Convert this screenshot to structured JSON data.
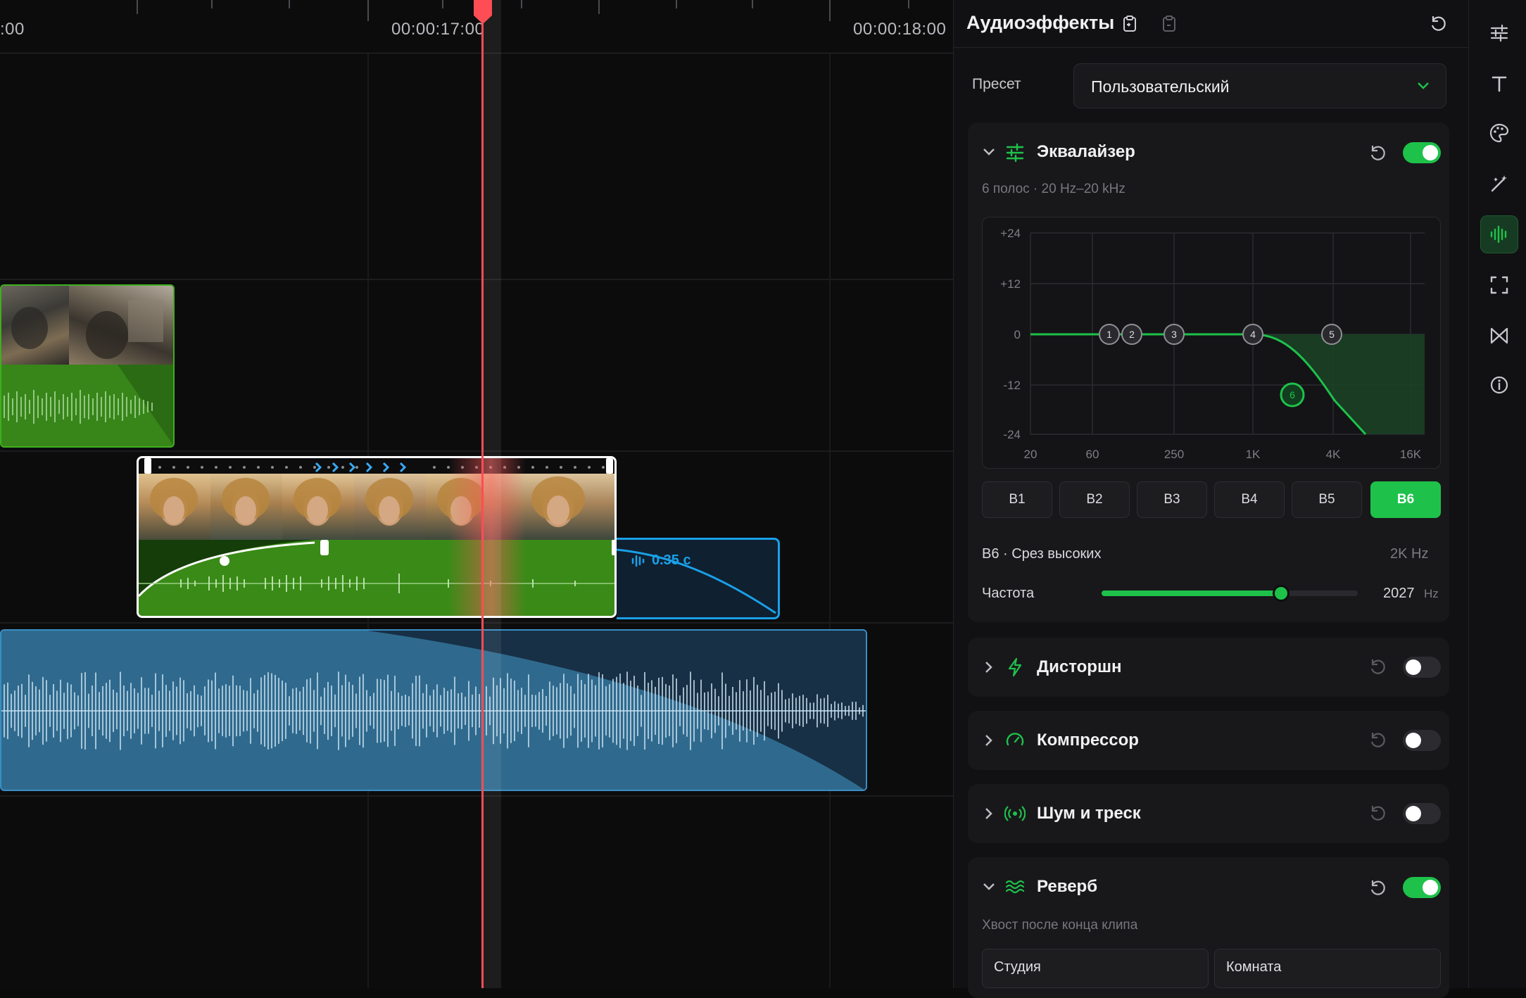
{
  "timeline": {
    "ruler": {
      "timecodes": [
        ":00",
        "00:00:17:00",
        "00:00:18:00"
      ]
    },
    "transition_label": "0.35 с"
  },
  "panel": {
    "title": "Аудиоэффекты",
    "preset": {
      "label": "Пресет",
      "value": "Пользовательский"
    },
    "equalizer": {
      "title": "Эквалайзер",
      "enabled": true,
      "subtitle": "6 полос · 20 Hz–20 kHz",
      "y_labels": [
        "+24",
        "+12",
        "0",
        "-12",
        "-24"
      ],
      "x_labels": [
        "20",
        "60",
        "250",
        "1K",
        "4K",
        "16K"
      ],
      "band_nodes": [
        "1",
        "2",
        "3",
        "4",
        "5",
        "6"
      ],
      "bands": [
        "B1",
        "B2",
        "B3",
        "B4",
        "B5",
        "B6"
      ],
      "active_band": "B6",
      "selected_band_title": "B6 · Срез высоких",
      "selected_band_freq": "2K Hz",
      "frequency_label": "Частота",
      "frequency_value": "2027",
      "frequency_unit": "Hz",
      "frequency_slider_fraction": 0.7
    },
    "distortion": {
      "title": "Дисторшн",
      "enabled": false
    },
    "compressor": {
      "title": "Компрессор",
      "enabled": false
    },
    "noise": {
      "title": "Шум и треск",
      "enabled": false
    },
    "reverb": {
      "title": "Реверб",
      "enabled": true,
      "subtitle": "Хвост после конца клипа",
      "presets": [
        "Студия",
        "Комната"
      ]
    }
  },
  "colors": {
    "accent": "#1ec24a",
    "playhead": "#ff4d55",
    "audio_clip": "#2f6a8e",
    "video_audio": "#3a8a17"
  }
}
